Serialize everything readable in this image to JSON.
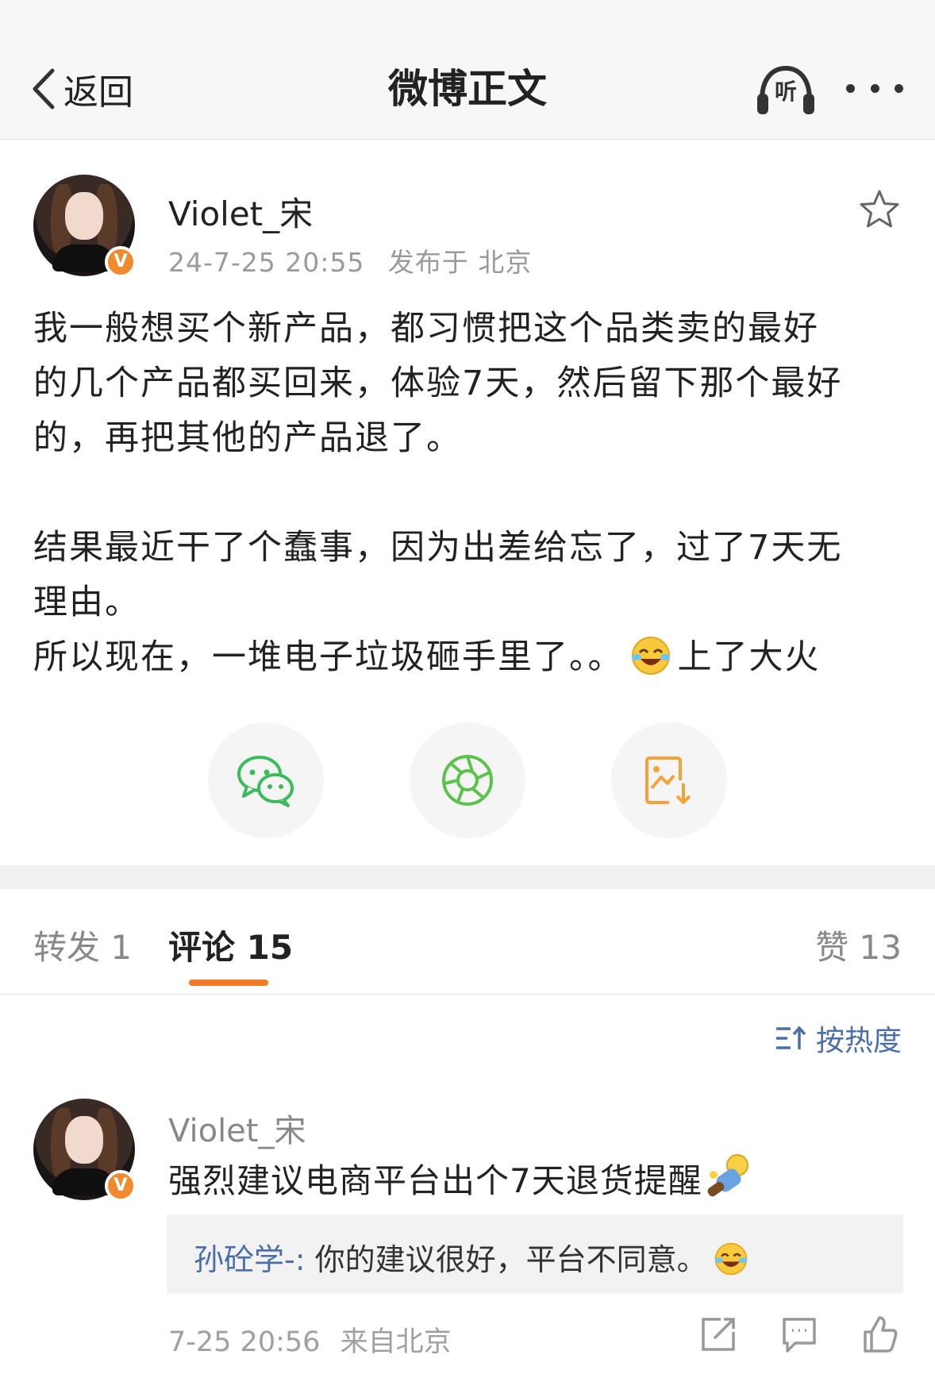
{
  "nav": {
    "back_label": "返回",
    "title": "微博正文",
    "listen_label": "听"
  },
  "post": {
    "username": "Violet_宋",
    "verified_badge": "V",
    "timestamp": "24-7-25 20:55",
    "location": "发布于 北京",
    "lines": [
      "我一般想买个新产品，都习惯把这个品类卖的最好",
      "的几个产品都买回来，体验7天，然后留下那个最好",
      "的，再把其他的产品退了。",
      "结果最近干了个蠢事，因为出差给忘了，过了7天无",
      "理由。",
      "所以现在，一堆电子垃圾砸手里了。。"
    ],
    "trailing_text": "上了大火",
    "emoji": "laugh-cry-emoji"
  },
  "share": {
    "wechat_icon": "wechat-icon",
    "moments_icon": "moments-icon",
    "save_image_icon": "save-image-icon"
  },
  "tabs": {
    "repost": "转发 1",
    "comment": "评论 15",
    "like": "赞 13"
  },
  "sort": {
    "label": "按热度"
  },
  "comment": {
    "username": "Violet_宋",
    "verified_badge": "V",
    "text": "强烈建议电商平台出个7天退货提醒",
    "reply": {
      "user": "孙砼学-:",
      "text": " 你的建议很好，平台不同意。"
    },
    "time": "7-25 20:56",
    "source": "来自北京"
  },
  "colors": {
    "accent_orange": "#f0792a",
    "link_blue": "#4a6ea8",
    "wechat_green": "#3dba5e",
    "moments_green": "#5bc24b",
    "save_orange": "#f3a33a"
  }
}
